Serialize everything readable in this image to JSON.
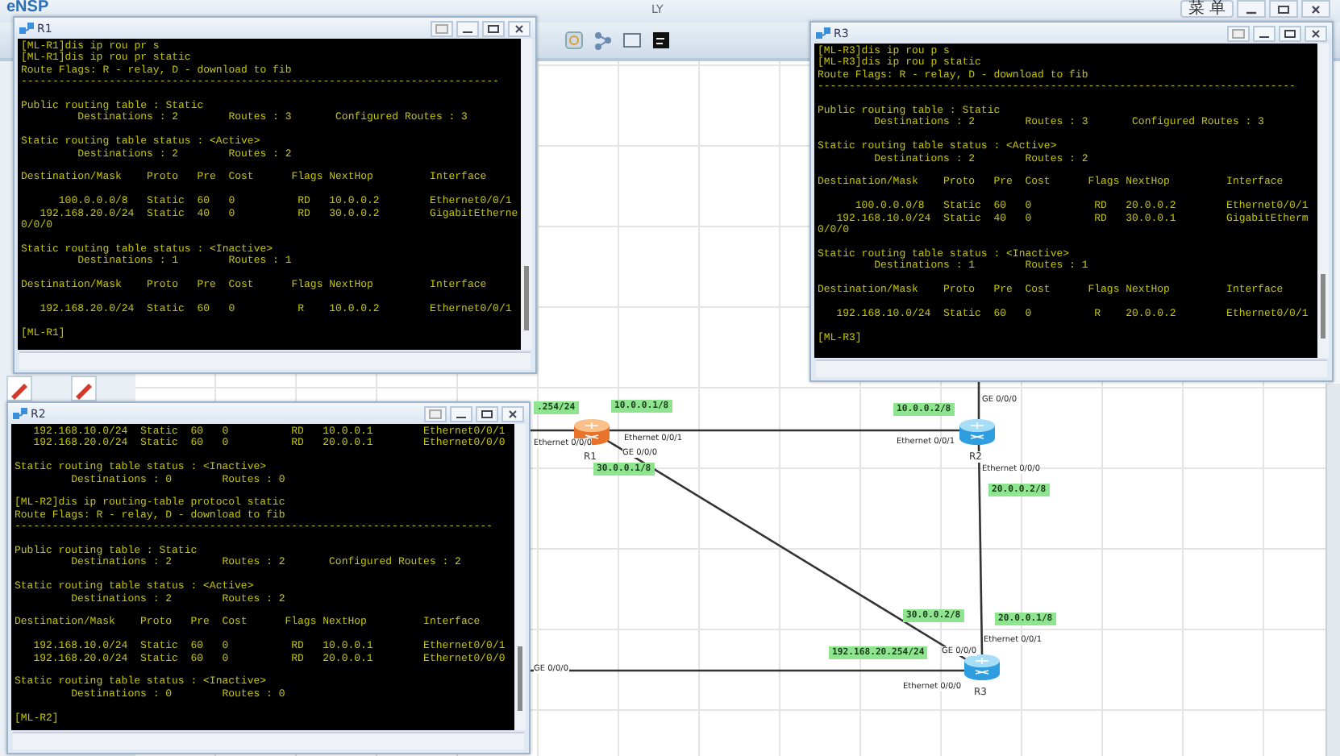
{
  "app": {
    "logo": "eNSP",
    "title": "LY",
    "menu": "菜 单"
  },
  "topology": {
    "devices": [
      {
        "label": "R1",
        "selected": true
      },
      {
        "label": "R2",
        "selected": false
      },
      {
        "label": "R3",
        "selected": false
      }
    ],
    "ports": [
      "Ethernet 0/0/0",
      "Ethernet 0/0/1",
      "GE 0/0/0",
      "GE 0/0/0",
      "Ethernet 0/0/1",
      "Ethernet 0/0/0",
      "Ethernet 0/0/1",
      "GE 0/0/0",
      "Ethernet 0/0/0",
      "GE 0/0/0"
    ],
    "addresses": [
      ".254/24",
      "10.0.0.1/8",
      "30.0.0.1/8",
      "10.0.0.2/8",
      "20.0.0.2/8",
      "30.0.0.2/8",
      "20.0.0.1/8",
      "192.168.20.254/24"
    ]
  },
  "terminals": [
    {
      "title": "R1",
      "blocks": [
        [
          "[ML-R1]dis ip rou pr s",
          "[ML-R1]dis ip rou pr static",
          "Route Flags: R - relay, D - download to fib",
          "----------------------------------------------------------------------------"
        ],
        [
          "Public routing table : Static",
          "         Destinations : 2        Routes : 3       Configured Routes : 3"
        ],
        [
          "Static routing table status : <Active>",
          "         Destinations : 2        Routes : 2"
        ],
        [
          "Destination/Mask    Proto   Pre  Cost      Flags NextHop         Interface"
        ],
        [
          "      100.0.0.0/8   Static  60   0          RD   10.0.0.2        Ethernet0/0/1",
          "   192.168.20.0/24  Static  40   0          RD   30.0.0.2        GigabitEtherne",
          "0/0/0"
        ],
        [
          "Static routing table status : <Inactive>",
          "         Destinations : 1        Routes : 1"
        ],
        [
          "Destination/Mask    Proto   Pre  Cost      Flags NextHop         Interface"
        ],
        [
          "   192.168.20.0/24  Static  60   0          R    10.0.0.2        Ethernet0/0/1"
        ],
        [
          "[ML-R1]"
        ]
      ]
    },
    {
      "title": "R3",
      "blocks": [
        [
          "[ML-R3]dis ip rou p s",
          "[ML-R3]dis ip rou p static",
          "Route Flags: R - relay, D - download to fib",
          "----------------------------------------------------------------------------"
        ],
        [
          "Public routing table : Static",
          "         Destinations : 2        Routes : 3       Configured Routes : 3"
        ],
        [
          "Static routing table status : <Active>",
          "         Destinations : 2        Routes : 2"
        ],
        [
          "Destination/Mask    Proto   Pre  Cost      Flags NextHop         Interface"
        ],
        [
          "      100.0.0.0/8   Static  60   0          RD   20.0.0.2        Ethernet0/0/1",
          "   192.168.10.0/24  Static  40   0          RD   30.0.0.1        GigabitEtherm",
          "0/0/0"
        ],
        [
          "Static routing table status : <Inactive>",
          "         Destinations : 1        Routes : 1"
        ],
        [
          "Destination/Mask    Proto   Pre  Cost      Flags NextHop         Interface"
        ],
        [
          "   192.168.10.0/24  Static  60   0          R    20.0.0.2        Ethernet0/0/1"
        ],
        [
          "[ML-R3]"
        ]
      ]
    },
    {
      "title": "R2",
      "blocks": [
        [
          "   192.168.10.0/24  Static  60   0          RD   10.0.0.1        Ethernet0/0/1",
          "   192.168.20.0/24  Static  60   0          RD   20.0.0.1        Ethernet0/0/0"
        ],
        [
          "Static routing table status : <Inactive>",
          "         Destinations : 0        Routes : 0"
        ],
        [
          "[ML-R2]dis ip routing-table protocol static",
          "Route Flags: R - relay, D - download to fib",
          "----------------------------------------------------------------------------"
        ],
        [
          "Public routing table : Static",
          "         Destinations : 2        Routes : 2       Configured Routes : 2"
        ],
        [
          "Static routing table status : <Active>",
          "         Destinations : 2        Routes : 2"
        ],
        [
          "Destination/Mask    Proto   Pre  Cost      Flags NextHop         Interface"
        ],
        [
          "   192.168.10.0/24  Static  60   0          RD   10.0.0.1        Ethernet0/0/1",
          "   192.168.20.0/24  Static  60   0          RD   20.0.0.1        Ethernet0/0/0"
        ],
        [
          "Static routing table status : <Inactive>",
          "         Destinations : 0        Routes : 0"
        ],
        [
          "[ML-R2]"
        ]
      ]
    }
  ]
}
